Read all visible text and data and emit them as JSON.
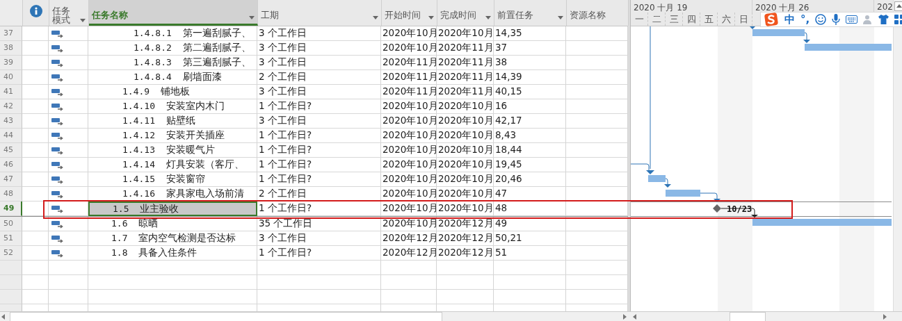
{
  "columns": [
    {
      "kind": "info",
      "selected": false
    },
    {
      "kind": "mode",
      "label": "任务模式",
      "dropdown": true,
      "selected": false
    },
    {
      "kind": "name",
      "label": "任务名称",
      "dropdown": true,
      "selected": true
    },
    {
      "kind": "duration",
      "label": "工期",
      "dropdown": true,
      "selected": false
    },
    {
      "kind": "start",
      "label": "开始时间",
      "dropdown": true,
      "selected": false
    },
    {
      "kind": "finish",
      "label": "完成时间",
      "dropdown": true,
      "selected": false
    },
    {
      "kind": "predecessors",
      "label": "前置任务",
      "dropdown": true,
      "selected": false
    },
    {
      "kind": "resources",
      "label": "资源名称",
      "dropdown": false,
      "selected": false
    }
  ],
  "rows": [
    {
      "children": [
        {
          "children": [
            {
              "id": "37",
              "wbs": "1.4.8.1",
              "name": "第一遍刮腻子、",
              "duration": "3 个工作日",
              "start": "2020年10月",
              "finish": "2020年10月",
              "predecessors": "14,35",
              "selected": false
            },
            {
              "id": "38",
              "wbs": "1.4.8.2",
              "name": "第二遍刮腻子、",
              "duration": "3 个工作日",
              "start": "2020年10月",
              "finish": "2020年11月",
              "predecessors": "37",
              "selected": false
            },
            {
              "id": "39",
              "wbs": "1.4.8.3",
              "name": "第三遍刮腻子、",
              "duration": "3 个工作日",
              "start": "2020年11月",
              "finish": "2020年11月",
              "predecessors": "38",
              "selected": false
            },
            {
              "id": "40",
              "wbs": "1.4.8.4",
              "name": "刷墙面漆",
              "duration": "2 个工作日",
              "start": "2020年11月",
              "finish": "2020年11月",
              "predecessors": "14,39",
              "selected": false
            }
          ]
        },
        {
          "id": "41",
          "wbs": "1.4.9",
          "name": "铺地板",
          "duration": "3 个工作日",
          "start": "2020年11月",
          "finish": "2020年11月",
          "predecessors": "40,15",
          "selected": false
        },
        {
          "id": "42",
          "wbs": "1.4.10",
          "name": "安装室内木门",
          "duration": "1 个工作日?",
          "start": "2020年10月",
          "finish": "2020年10月",
          "predecessors": "16",
          "selected": false
        },
        {
          "id": "43",
          "wbs": "1.4.11",
          "name": "贴壁纸",
          "duration": "3 个工作日",
          "start": "2020年10月",
          "finish": "2020年10月",
          "predecessors": "42,17",
          "selected": false
        },
        {
          "id": "44",
          "wbs": "1.4.12",
          "name": "安装开关插座",
          "duration": "1 个工作日?",
          "start": "2020年10月",
          "finish": "2020年10月",
          "predecessors": "8,43",
          "selected": false
        },
        {
          "id": "45",
          "wbs": "1.4.13",
          "name": "安装暖气片",
          "duration": "1 个工作日?",
          "start": "2020年10月",
          "finish": "2020年10月",
          "predecessors": "18,44",
          "selected": false
        },
        {
          "id": "46",
          "wbs": "1.4.14",
          "name": "灯具安装（客厅、",
          "duration": "1 个工作日?",
          "start": "2020年10月",
          "finish": "2020年10月",
          "predecessors": "19,45",
          "selected": false
        },
        {
          "id": "47",
          "wbs": "1.4.15",
          "name": "安装窗帘",
          "duration": "1 个工作日?",
          "start": "2020年10月",
          "finish": "2020年10月",
          "predecessors": "20,46",
          "selected": false
        },
        {
          "id": "48",
          "wbs": "1.4.16",
          "name": "家具家电入场前清",
          "duration": "2 个工作日",
          "start": "2020年10月",
          "finish": "2020年10月",
          "predecessors": "47",
          "selected": false
        }
      ]
    },
    {
      "id": "49",
      "wbs": "1.5",
      "name": "业主验收",
      "duration": "1 个工作日?",
      "start": "2020年10月",
      "finish": "2020年10月",
      "predecessors": "48",
      "selected": true,
      "milestone_label": "10/23"
    },
    {
      "id": "50",
      "wbs": "1.6",
      "name": "晾晒",
      "duration": "35 个工作日",
      "start": "2020年10月",
      "finish": "2020年12月",
      "predecessors": "49",
      "selected": false
    },
    {
      "id": "51",
      "wbs": "1.7",
      "name": "室内空气检测是否达标",
      "duration": "3 个工作日",
      "start": "2020年12月",
      "finish": "2020年12月",
      "predecessors": "50,21",
      "selected": false
    },
    {
      "id": "52",
      "wbs": "1.8",
      "name": "具备入住条件",
      "duration": "1 个工作日?",
      "start": "2020年12月",
      "finish": "2020年12月",
      "predecessors": "51",
      "selected": false
    }
  ],
  "timescale": {
    "weeks": [
      "2020 十月 19",
      "2020 十月 26",
      "202"
    ],
    "days": [
      "一",
      "二",
      "三",
      "四",
      "五",
      "六",
      "日"
    ]
  },
  "ime_toolbar": {
    "mode": "中",
    "punctuation": "°,"
  }
}
